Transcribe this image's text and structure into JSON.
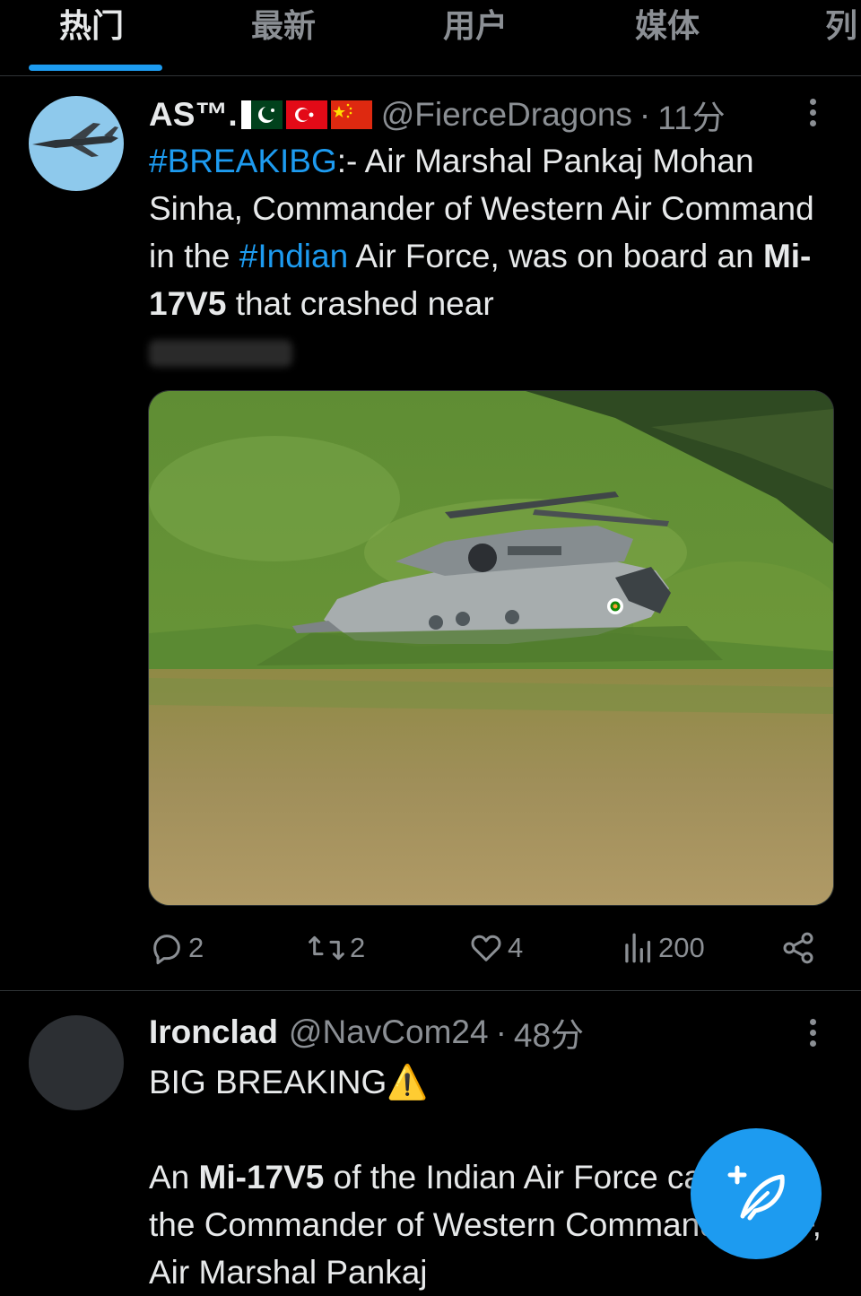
{
  "tabs": [
    {
      "label": "热门",
      "active": true
    },
    {
      "label": "最新",
      "active": false
    },
    {
      "label": "用户",
      "active": false
    },
    {
      "label": "媒体",
      "active": false
    },
    {
      "label": "列",
      "active": false
    }
  ],
  "tweet1": {
    "name": "AS™.",
    "flags": [
      "flag-pakistan-icon",
      "flag-turkey-icon",
      "flag-china-icon"
    ],
    "handle": "@FierceDragons",
    "dot": "·",
    "time": "11分",
    "body": {
      "hashtag1": "#BREAKIBG",
      "p1": ":- Air Marshal Pankaj Mohan Sinha, Commander of Western Air Command in the ",
      "hashtag2": "#Indian",
      "p2": " Air Force, was on board an ",
      "bold1": "Mi-17V5",
      "p3": " that crashed near"
    },
    "media_icon": "helicopter-crash-photo",
    "stats": {
      "replies": "2",
      "retweets": "2",
      "likes": "4",
      "views": "200"
    }
  },
  "tweet2": {
    "name": "Ironclad",
    "handle": "@NavCom24",
    "dot": "·",
    "time": "48分",
    "line1": "BIG BREAKING",
    "warning_icon": "⚠️",
    "p_start": "An ",
    "bold1": "Mi-17V5",
    "p_rest": " of the Indian Air Force carrying the Commander of Western Command of IAF, Air Marshal Pankaj"
  },
  "fab": {
    "icon": "compose-feather-icon"
  },
  "colors": {
    "accent": "#1d9bf0",
    "background": "#000000",
    "text": "#e7e9ea",
    "secondary": "#8b8f94"
  }
}
